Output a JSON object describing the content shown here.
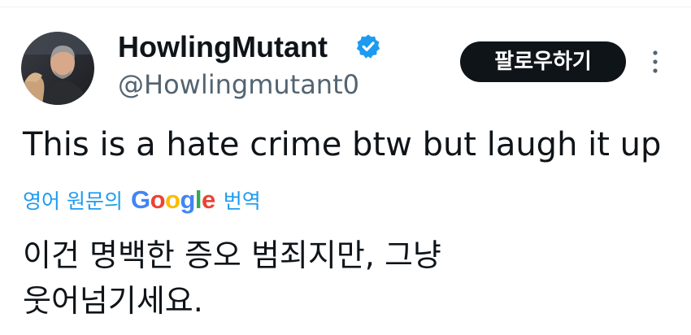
{
  "tweet": {
    "author": {
      "display_name": "HowlingMutant",
      "handle": "@Howlingmutant0",
      "verified": true,
      "avatar": "profile-photo"
    },
    "follow_label": "팔로우하기",
    "more_icon": "more-vertical-icon",
    "text": "This is a hate crime btw but laugh it up",
    "translate": {
      "prefix": "영어 원문의",
      "provider_letters": [
        "G",
        "o",
        "o",
        "g",
        "l",
        "e"
      ],
      "provider_colors": [
        "#4285f4",
        "#ea4335",
        "#fbbc05",
        "#4285f4",
        "#34a853",
        "#ea4335"
      ],
      "suffix": "번역"
    },
    "translated_lines": [
      "이건 명백한 증오 범죄지만, 그냥",
      "웃어넘기세요."
    ]
  },
  "colors": {
    "accent": "#1d9bf0",
    "verified_badge": "#1d9bf0",
    "text_primary": "#0f1419",
    "text_secondary": "#536471",
    "follow_button_bg": "#0f1419"
  }
}
